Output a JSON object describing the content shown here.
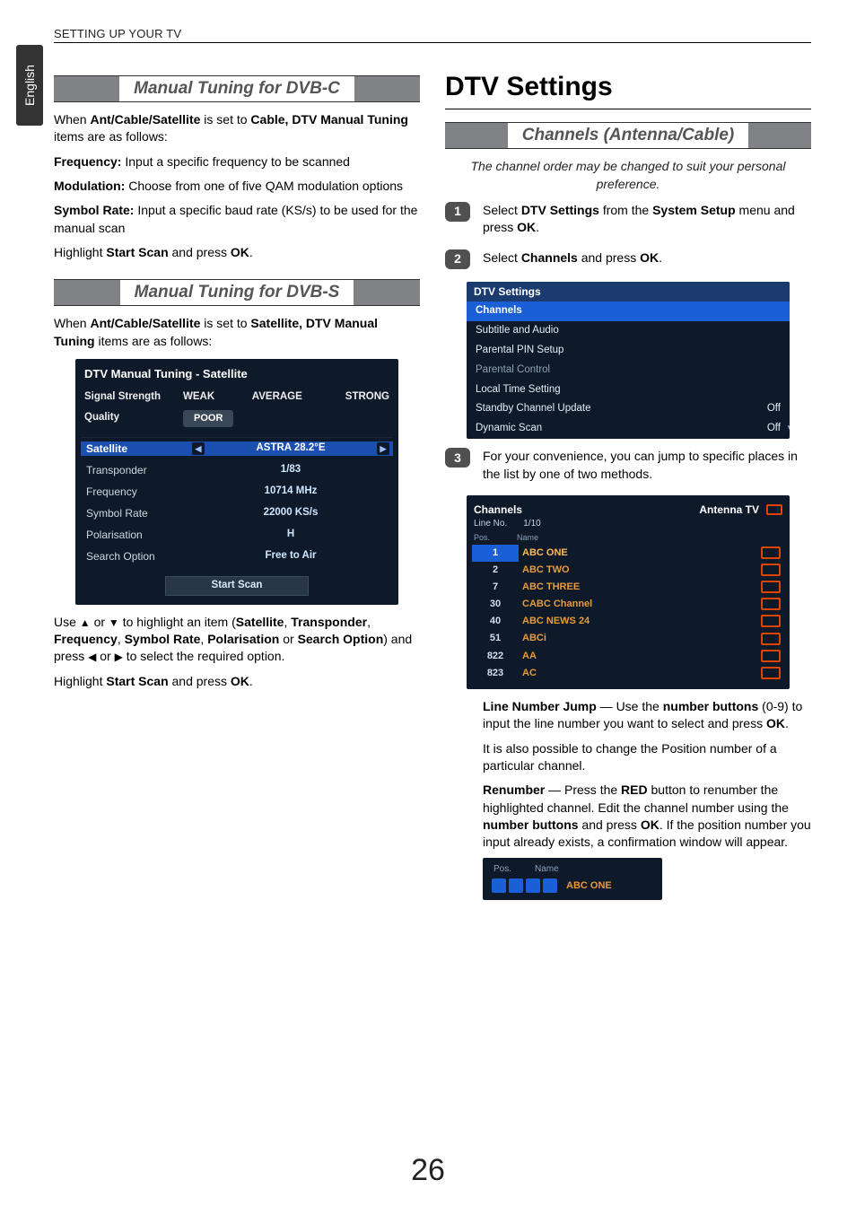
{
  "running_head": "SETTING UP YOUR TV",
  "languageTab": "English",
  "pageNumber": "26",
  "left": {
    "sec1": {
      "title": "Manual Tuning for DVB-C",
      "intro_a": "When ",
      "intro_b": "Ant/Cable/Satellite",
      "intro_c": " is set to ",
      "intro_d": "Cable, DTV Manual Tuning",
      "intro_e": " items are as follows:",
      "freq_label": "Frequency:",
      "freq_text": " Input a specific frequency to be scanned",
      "mod_label": "Modulation:",
      "mod_text": " Choose from one of five QAM modulation options",
      "sym_label": "Symbol Rate:",
      "sym_text": " Input a specific baud rate (KS/s) to be used for the manual scan",
      "hl_a": "Highlight ",
      "hl_b": "Start Scan",
      "hl_c": " and press ",
      "hl_d": "OK",
      "hl_e": "."
    },
    "sec2": {
      "title": "Manual Tuning for DVB-S",
      "intro_a": "When ",
      "intro_b": "Ant/Cable/Satellite",
      "intro_c": " is set to ",
      "intro_d": "Satellite, DTV Manual Tuning",
      "intro_e": " items are as follows:",
      "osd": {
        "title": "DTV Manual Tuning - Satellite",
        "sig_label": "Signal Strength",
        "qual_label": "Quality",
        "weak": "WEAK",
        "avg": "AVERAGE",
        "strong": "STRONG",
        "poor": "POOR",
        "rows": {
          "sat_l": "Satellite",
          "sat_v": "ASTRA 28.2°E",
          "tp_l": "Transponder",
          "tp_v": "1/83",
          "fr_l": "Frequency",
          "fr_v": "10714 MHz",
          "sr_l": "Symbol Rate",
          "sr_v": "22000 KS/s",
          "po_l": "Polarisation",
          "po_v": "H",
          "so_l": "Search Option",
          "so_v": "Free to Air"
        },
        "start": "Start Scan"
      },
      "use_a": "Use ",
      "use_b": " or ",
      "use_c": " to highlight an item (",
      "use_sat": "Satellite",
      "sep": ", ",
      "use_tp": "Transponder",
      "use_fr": "Frequency",
      "use_sr": "Symbol Rate",
      "use_po": "Polarisation",
      "or": " or ",
      "use_so": "Search Option",
      "use_end1": ") and press ",
      "use_end2": " or ",
      "use_end3": " to select the required option.",
      "hl_a": "Highlight ",
      "hl_b": "Start Scan",
      "hl_c": " and press ",
      "hl_d": "OK",
      "hl_e": "."
    }
  },
  "right": {
    "h1": "DTV Settings",
    "sec": {
      "title": "Channels (Antenna/Cable)"
    },
    "note": "The channel order may be changed to suit your personal preference.",
    "step1_a": "Select ",
    "step1_b": "DTV Settings",
    "step1_c": " from the ",
    "step1_d": "System Setup",
    "step1_e": " menu and press ",
    "step1_f": "OK",
    "step1_g": ".",
    "step2_a": "Select ",
    "step2_b": "Channels",
    "step2_c": " and press ",
    "step2_d": "OK",
    "step2_e": ".",
    "menu": {
      "hdr": "DTV Settings",
      "r1": "Channels",
      "r2": "Subtitle and Audio",
      "r3": "Parental PIN Setup",
      "r4": "Parental Control",
      "r5": "Local Time Setting",
      "r6": "Standby Channel Update",
      "r6v": "Off",
      "r7": "Dynamic Scan",
      "r7v": "Off"
    },
    "step3": "For your convenience, you can jump to specific places in the list by one of two methods.",
    "chan": {
      "title": "Channels",
      "ant": "Antenna TV",
      "line_no_l": "Line No.",
      "line_no_v": "1/10",
      "pos_h": "Pos.",
      "name_h": "Name",
      "rows": [
        {
          "pos": "1",
          "name": "ABC ONE"
        },
        {
          "pos": "2",
          "name": "ABC TWO"
        },
        {
          "pos": "7",
          "name": "ABC THREE"
        },
        {
          "pos": "30",
          "name": "CABC Channel"
        },
        {
          "pos": "40",
          "name": "ABC NEWS 24"
        },
        {
          "pos": "51",
          "name": "ABCi"
        },
        {
          "pos": "822",
          "name": "AA"
        },
        {
          "pos": "823",
          "name": "AC"
        }
      ]
    },
    "lnj_a": "Line Number Jump",
    "lnj_b": " — Use the ",
    "lnj_c": "number buttons",
    "lnj_d": " (0-9) to input the line number you want to select and press ",
    "lnj_e": "OK",
    "lnj_f": ".",
    "also": "It is also possible to change the Position number of a particular channel.",
    "ren_a": "Renumber",
    "ren_b": " — Press the ",
    "ren_c": "RED",
    "ren_d": " button to renumber the highlighted channel. Edit the channel number using the ",
    "ren_e": "number buttons",
    "ren_f": " and press ",
    "ren_g": "OK",
    "ren_h": ". If the position number you input already exists, a confirmation window will appear.",
    "renum": {
      "pos": "Pos.",
      "name": "Name",
      "val": "ABC ONE"
    }
  }
}
